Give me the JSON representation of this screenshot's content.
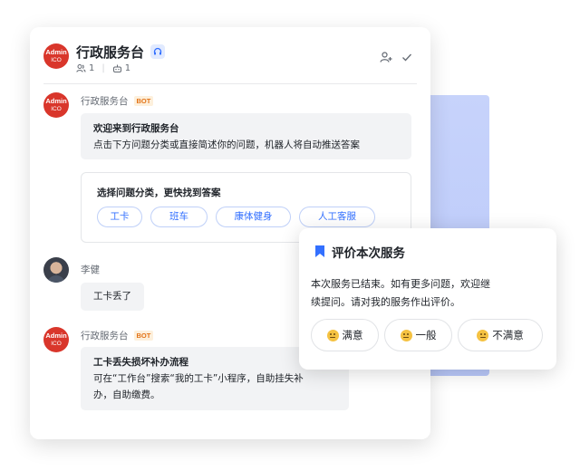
{
  "header": {
    "title": "行政服务台",
    "avatar_line1": "Admin",
    "avatar_line2": "ICO",
    "member_count": "1",
    "bot_count": "1"
  },
  "messages": {
    "bot_name": "行政服务台",
    "bot_tag": "BOT",
    "welcome_title": "欢迎来到行政服务台",
    "welcome_text": "点击下方问题分类或直接简述你的问题，机器人将自动推送答案",
    "category_card_title": "选择问题分类，更快找到答案",
    "categories": [
      "工卡",
      "班车",
      "康体健身",
      "人工客服"
    ],
    "user_name": "李健",
    "user_message": "工卡丢了",
    "answer_title": "工卡丢失损坏补办流程",
    "answer_text_line1": "可在“工作台”搜索“我的工卡”小程序，自助挂失补",
    "answer_text_line2": "办，自助缴费。"
  },
  "rating": {
    "title": "评价本次服务",
    "body_line1": "本次服务已结束。如有更多问题，欢迎继",
    "body_line2": "续提问。请对我的服务作出评价。",
    "options": [
      "满意",
      "一般",
      "不满意"
    ]
  },
  "icons": {
    "badge": "support-headset-icon",
    "members": "members-icon",
    "bots": "bot-icon",
    "add_member": "add-member-icon",
    "check": "check-icon",
    "bookmark": "bookmark-icon",
    "emoji": "smiley-emoji-icon"
  },
  "colors": {
    "brand_red": "#d9362b",
    "accent_blue": "#3370ff",
    "bot_tag_orange": "#e37318"
  }
}
